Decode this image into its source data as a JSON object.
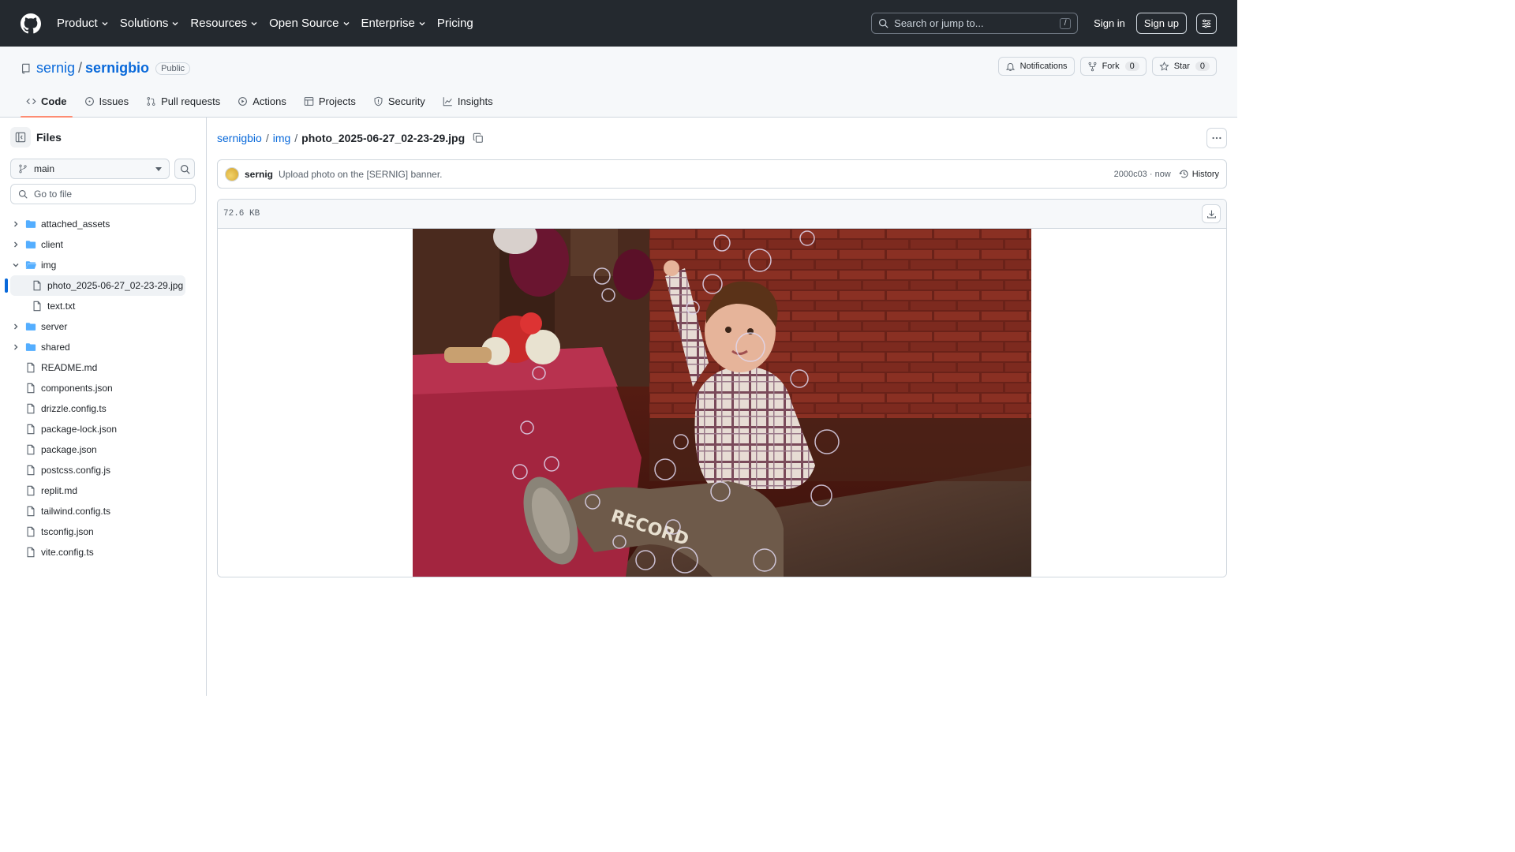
{
  "header": {
    "nav": [
      "Product",
      "Solutions",
      "Resources",
      "Open Source",
      "Enterprise",
      "Pricing"
    ],
    "search_placeholder": "Search or jump to...",
    "search_shortcut": "/",
    "sign_in": "Sign in",
    "sign_up": "Sign up"
  },
  "repo": {
    "owner": "sernig",
    "separator": "/",
    "name": "sernigbio",
    "visibility": "Public",
    "notifications_label": "Notifications",
    "fork_label": "Fork",
    "fork_count": "0",
    "star_label": "Star",
    "star_count": "0"
  },
  "tabs": [
    {
      "label": "Code",
      "icon": "code-icon",
      "active": true
    },
    {
      "label": "Issues",
      "icon": "issue-icon"
    },
    {
      "label": "Pull requests",
      "icon": "pull-request-icon"
    },
    {
      "label": "Actions",
      "icon": "play-icon"
    },
    {
      "label": "Projects",
      "icon": "table-icon"
    },
    {
      "label": "Security",
      "icon": "shield-icon"
    },
    {
      "label": "Insights",
      "icon": "graph-icon"
    }
  ],
  "sidebar": {
    "title": "Files",
    "branch": "main",
    "goto_placeholder": "Go to file",
    "tree": [
      {
        "name": "attached_assets",
        "type": "dir",
        "expanded": false
      },
      {
        "name": "client",
        "type": "dir",
        "expanded": false
      },
      {
        "name": "img",
        "type": "dir",
        "expanded": true
      },
      {
        "name": "photo_2025-06-27_02-23-29.jpg",
        "type": "file",
        "child": true,
        "selected": true
      },
      {
        "name": "text.txt",
        "type": "file",
        "child": true
      },
      {
        "name": "server",
        "type": "dir",
        "expanded": false
      },
      {
        "name": "shared",
        "type": "dir",
        "expanded": false
      },
      {
        "name": "README.md",
        "type": "file"
      },
      {
        "name": "components.json",
        "type": "file"
      },
      {
        "name": "drizzle.config.ts",
        "type": "file"
      },
      {
        "name": "package-lock.json",
        "type": "file"
      },
      {
        "name": "package.json",
        "type": "file"
      },
      {
        "name": "postcss.config.js",
        "type": "file"
      },
      {
        "name": "replit.md",
        "type": "file"
      },
      {
        "name": "tailwind.config.ts",
        "type": "file"
      },
      {
        "name": "tsconfig.json",
        "type": "file"
      },
      {
        "name": "vite.config.ts",
        "type": "file"
      }
    ]
  },
  "breadcrumb": {
    "repo": "sernigbio",
    "dir": "img",
    "file": "photo_2025-06-27_02-23-29.jpg",
    "sep": "/"
  },
  "commit": {
    "author": "sernig",
    "message": "Upload photo on the [SERNIG] banner.",
    "meta": "2000c03 · now",
    "history_label": "History"
  },
  "blob": {
    "size": "72.6 KB"
  },
  "colors": {
    "header_bg": "#24292f",
    "link": "#0969da",
    "active_tab": "#fd8c73"
  }
}
